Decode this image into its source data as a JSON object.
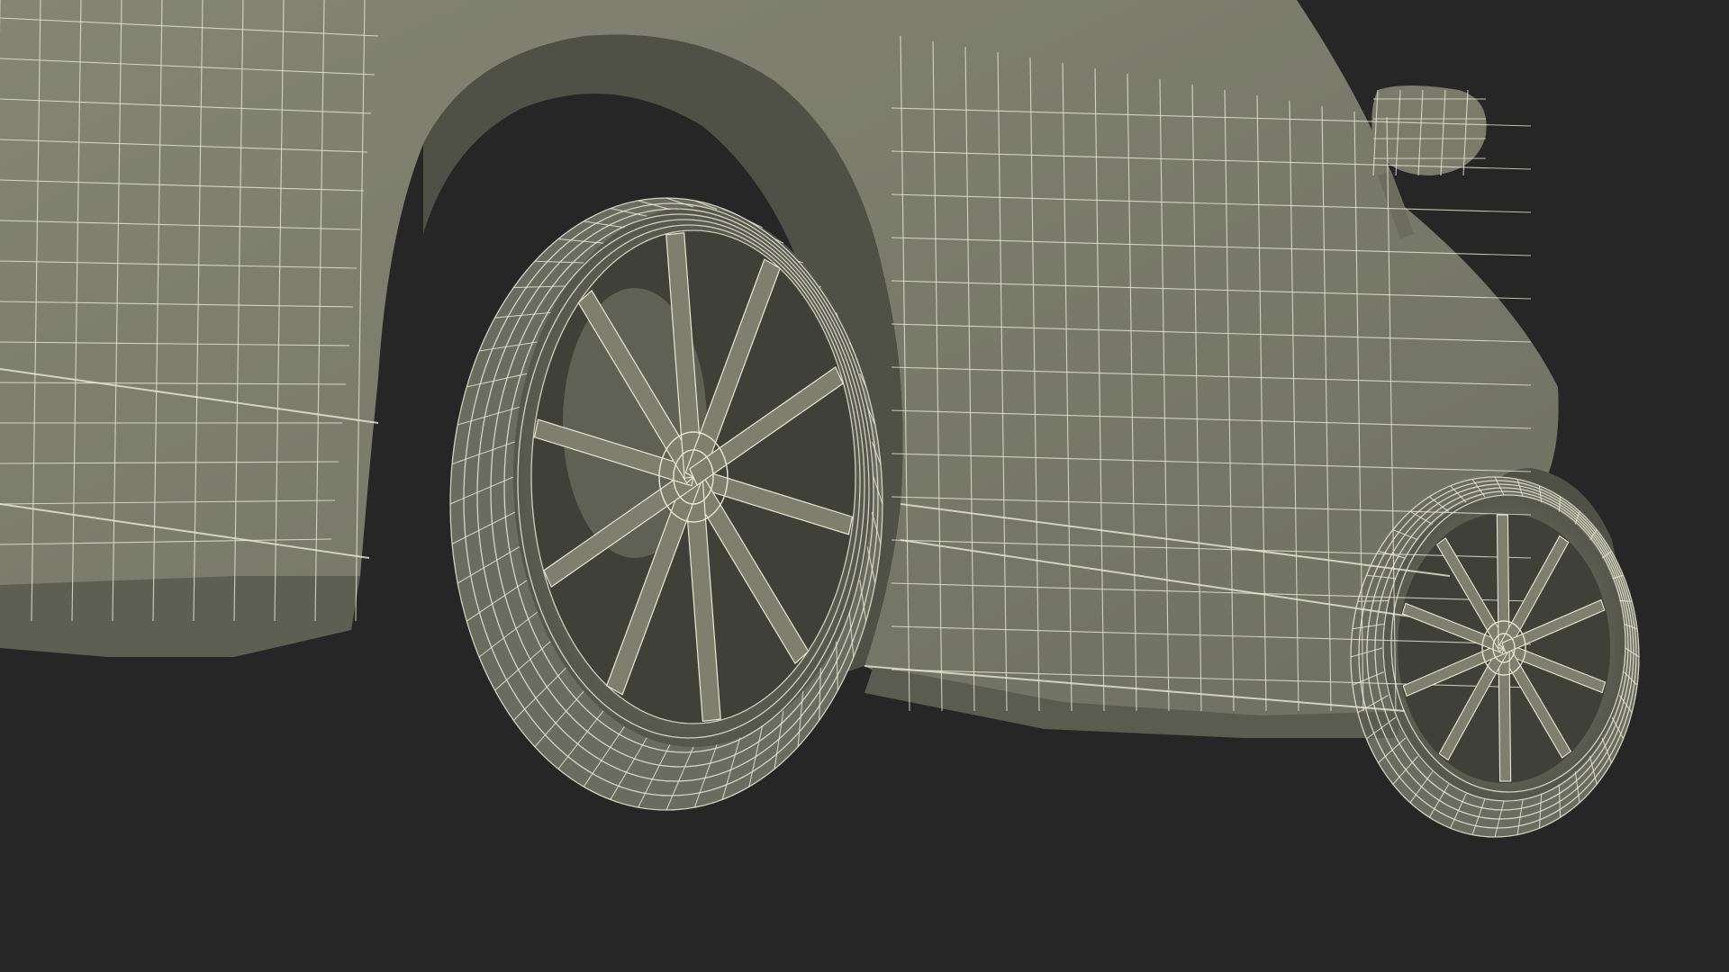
{
  "scene": {
    "background_color": "#262626",
    "surface_color": "#7e7e6d",
    "surface_shadow_color": "#55574a",
    "wire_color": "#e9e8d6",
    "view": "3d-wireframe-render",
    "subject": "car-rear-and-side-wireframe"
  }
}
